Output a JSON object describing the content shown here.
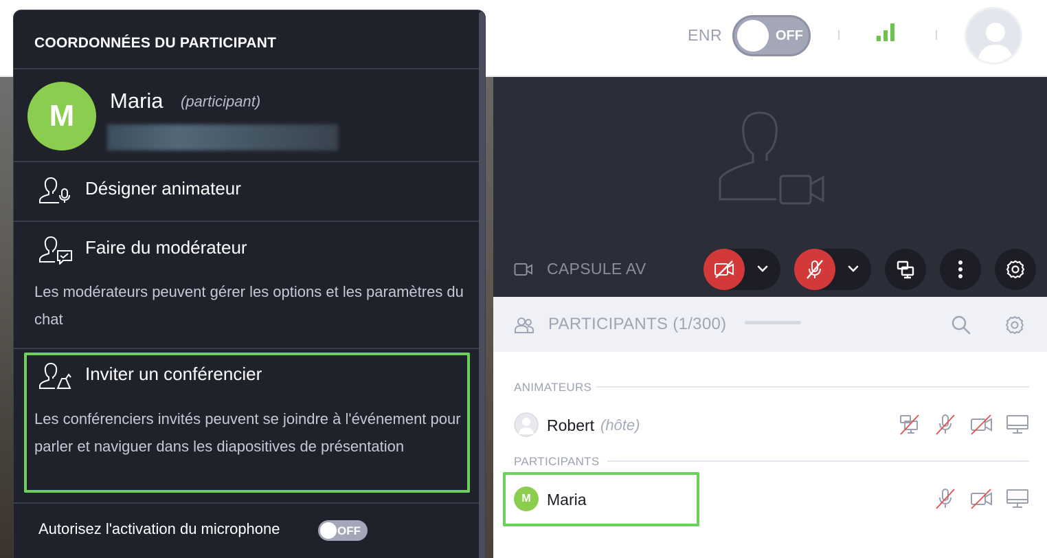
{
  "header": {
    "record_label": "ENR",
    "record_toggle_state": "OFF"
  },
  "video": {
    "camera_label": "CAPSULE AV"
  },
  "participants_panel": {
    "title": "PARTICIPANTS (1/300)",
    "sections": [
      {
        "label": "ANIMATEURS",
        "people": [
          {
            "name": "Robert",
            "role": "(hôte)"
          }
        ]
      },
      {
        "label": "PARTICIPANTS",
        "people": [
          {
            "name": "Maria",
            "initial": "M"
          }
        ]
      }
    ]
  },
  "popup": {
    "title": "COORDONNÉES DU PARTICIPANT",
    "participant": {
      "initial": "M",
      "name": "Maria",
      "role": "(participant)"
    },
    "actions": [
      {
        "label": "Désigner animateur",
        "icon": "user-mic-icon"
      },
      {
        "label": "Faire du modérateur",
        "icon": "user-chat-icon",
        "description": "Les modérateurs peuvent gérer les options et les paramètres du chat"
      },
      {
        "label": "Inviter un conférencier",
        "icon": "user-speaker-icon",
        "description": "Les conférenciers invités peuvent se joindre à l'événement pour parler et naviguer dans les diapositives de présentation",
        "highlighted": true
      }
    ],
    "mic_permission": {
      "label": "Autorisez l'activation du microphone",
      "state": "OFF"
    }
  },
  "colors": {
    "accent_green": "#6bd15b",
    "danger_red": "#d23a3a",
    "popup_bg": "#1f212b",
    "avatar_green": "#8bcd4f"
  }
}
